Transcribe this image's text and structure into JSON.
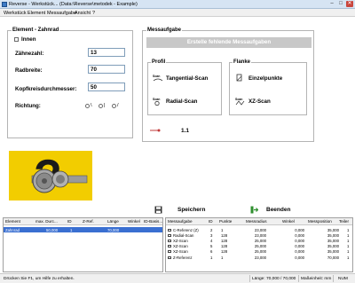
{
  "window": {
    "title": "Reverse - Werkstück... (Data:\\Reverse\\metodek - Example)",
    "minimize": "–",
    "maximize": "□",
    "close": "✕"
  },
  "menu": [
    "Werkstück",
    "Element",
    "Messaufgabe",
    "Ansicht",
    "?"
  ],
  "element": {
    "legend": "Element - Zahnrad",
    "innen_label": "Innen",
    "zaehnezahl_label": "Zähnezahl:",
    "zaehnezahl_value": "13",
    "radbreite_label": "Radbreite:",
    "radbreite_value": "70",
    "kopfkreis_label": "Kopfkreisdurchmesser:",
    "kopfkreis_value": "50",
    "richtung_label": "Richtung:",
    "richtung_options": [
      "\\",
      "|",
      "/"
    ]
  },
  "messaufgabe": {
    "legend": "Messaufgabe",
    "generate_button": "Erstelle fehlende Messaufgaben",
    "profil": {
      "legend": "Profil",
      "tangential": "Tangential-Scan",
      "radial": "Radial-Scan",
      "scan_icon_text": "Scan"
    },
    "flanke": {
      "legend": "Flanke",
      "einzelpunkte": "Einzelpunkte",
      "xz_scan": "XZ-Scan",
      "scan_icon_text": "Scan"
    },
    "version_label": "1.1"
  },
  "actions": {
    "save": "Speichern",
    "exit": "Beenden"
  },
  "element_table": {
    "headers": [
      "Element",
      "max. Durc...",
      "ID",
      "Z-Ref.",
      "Länge",
      "Winkel",
      "ID-Basis..."
    ],
    "rows": [
      [
        "Zahnrad",
        "50,000",
        "1",
        "",
        "70,000",
        "",
        ""
      ]
    ]
  },
  "task_table": {
    "headers": [
      "Messaufgabe",
      "ID",
      "Punkte",
      "Messradius",
      "Winkel",
      "Messposition",
      "Teiler"
    ],
    "rows": [
      [
        "C-Referenz (Z)",
        "2",
        "1",
        "23,000",
        "0,000",
        "35,000",
        "1"
      ],
      [
        "Radial-Scan",
        "3",
        "128",
        "23,000",
        "0,000",
        "35,000",
        "1"
      ],
      [
        "XZ-Scan",
        "4",
        "128",
        "25,000",
        "0,000",
        "35,000",
        "1"
      ],
      [
        "XZ-Scan",
        "5",
        "128",
        "25,000",
        "0,000",
        "35,000",
        "1"
      ],
      [
        "XZ-Scan",
        "6",
        "128",
        "25,000",
        "0,000",
        "35,000",
        "1"
      ],
      [
        "Z-Referenz",
        "1",
        "1",
        "23,000",
        "0,000",
        "70,000",
        "1"
      ]
    ]
  },
  "status": {
    "help": "Drücken Sie F1, um Hilfe zu erhalten.",
    "length": "Länge: 70,000 / 70,000",
    "unit": "Maßeinheit: mm",
    "num": "NUM"
  },
  "colors": {
    "titlebar": "#d6e4f3",
    "selection": "#3a6fd1",
    "image_bg": "#f2cd00",
    "grey_button": "#c8c8c8"
  }
}
